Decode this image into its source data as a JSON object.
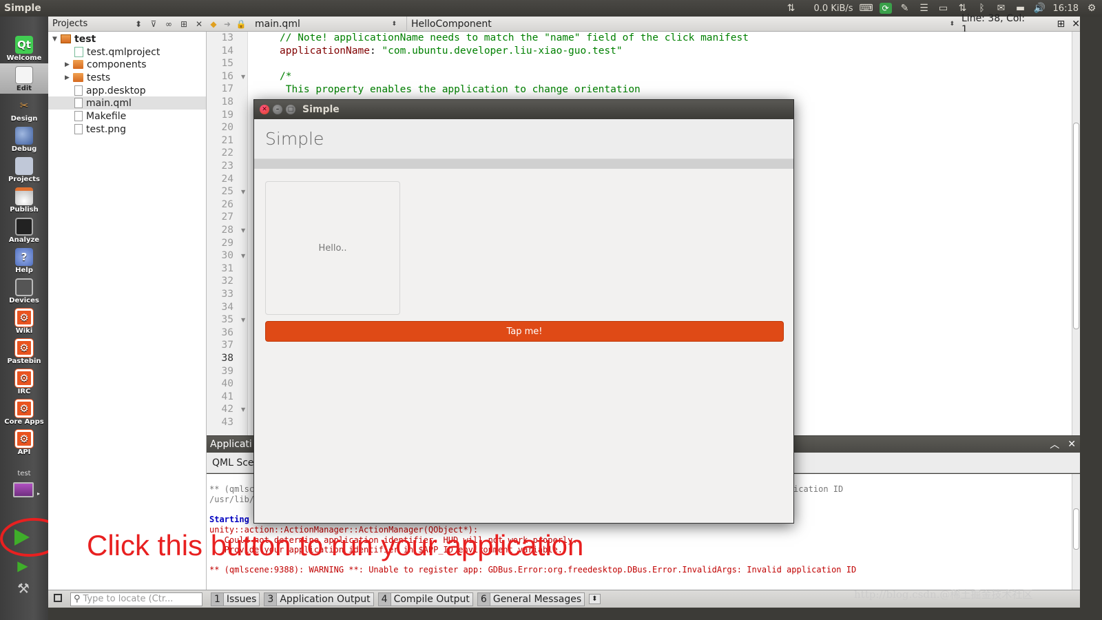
{
  "top_panel": {
    "app_title": "Simple",
    "net_speed": "0.0 KiB/s",
    "clock": "16:18"
  },
  "modebar": {
    "modes": [
      {
        "label": "Welcome"
      },
      {
        "label": "Edit"
      },
      {
        "label": "Design"
      },
      {
        "label": "Debug"
      },
      {
        "label": "Projects"
      },
      {
        "label": "Publish"
      },
      {
        "label": "Analyze"
      },
      {
        "label": "Help"
      },
      {
        "label": "Devices"
      },
      {
        "label": "Wiki"
      },
      {
        "label": "Pastebin"
      },
      {
        "label": "IRC"
      },
      {
        "label": "Core Apps"
      },
      {
        "label": "API"
      }
    ],
    "active_mode": "Edit",
    "kit_label": "test",
    "qt_logo_text": "Qt"
  },
  "projects": {
    "header": "Projects",
    "tree": [
      {
        "label": "test",
        "bold": true
      },
      {
        "label": "test.qmlproject"
      },
      {
        "label": "components"
      },
      {
        "label": "tests"
      },
      {
        "label": "app.desktop"
      },
      {
        "label": "main.qml",
        "selected": true
      },
      {
        "label": "Makefile"
      },
      {
        "label": "test.png"
      }
    ]
  },
  "editor": {
    "document": "main.qml",
    "symbol": "HelloComponent",
    "position": "Line: 38, Col: 1",
    "line_numbers": [
      "13",
      "14",
      "15",
      "16",
      "17",
      "18",
      "19",
      "20",
      "21",
      "22",
      "23",
      "24",
      "25",
      "26",
      "27",
      "28",
      "29",
      "30",
      "31",
      "32",
      "33",
      "34",
      "35",
      "36",
      "37",
      "38",
      "39",
      "40",
      "41",
      "42",
      "43"
    ],
    "current_line": "38",
    "code": {
      "l13": "// Note! applicationName needs to match the \"name\" field of the click manifest",
      "l14_prop": "applicationName",
      "l14_sep": ": ",
      "l14_str": "\"com.ubuntu.developer.liu-xiao-guo.test\"",
      "l16": "/*",
      "l17": " This property enables the application to change orientation"
    }
  },
  "output": {
    "header": "Applicati",
    "tab_label": "QML Scer",
    "lines": {
      "l1": "** (qmlsc",
      "l1_tail": "ication ID",
      "l2": "/usr/lib/",
      "starting": "Starting",
      "l3": "unity::action::ActionManager::ActionManager(QObject*):",
      "l4": "   Could not determine application identifier. HUD will not work properly.",
      "l5": "   Provide your application identifier in $APP_ID environment variable.",
      "l6": "** (qmlscene:9388): WARNING **: Unable to register app: GDBus.Error:org.freedesktop.DBus.Error.InvalidArgs: Invalid application ID"
    }
  },
  "status_bar": {
    "locator_placeholder": "Type to locate (Ctr...",
    "tabs": [
      {
        "num": "1",
        "label": "Issues"
      },
      {
        "num": "3",
        "label": "Application Output"
      },
      {
        "num": "4",
        "label": "Compile Output"
      },
      {
        "num": "6",
        "label": "General Messages"
      }
    ]
  },
  "app_window": {
    "title": "Simple",
    "header": "Simple",
    "hello_text": "Hello..",
    "button_label": "Tap me!"
  },
  "annotation": {
    "text": "Click this button to run your application"
  },
  "watermark": "http://blog.csdn.@稀土掘金技术社区",
  "colors": {
    "ubuntu_orange": "#df4a16",
    "run_green": "#3fae2a",
    "annotation_red": "#e82020"
  }
}
